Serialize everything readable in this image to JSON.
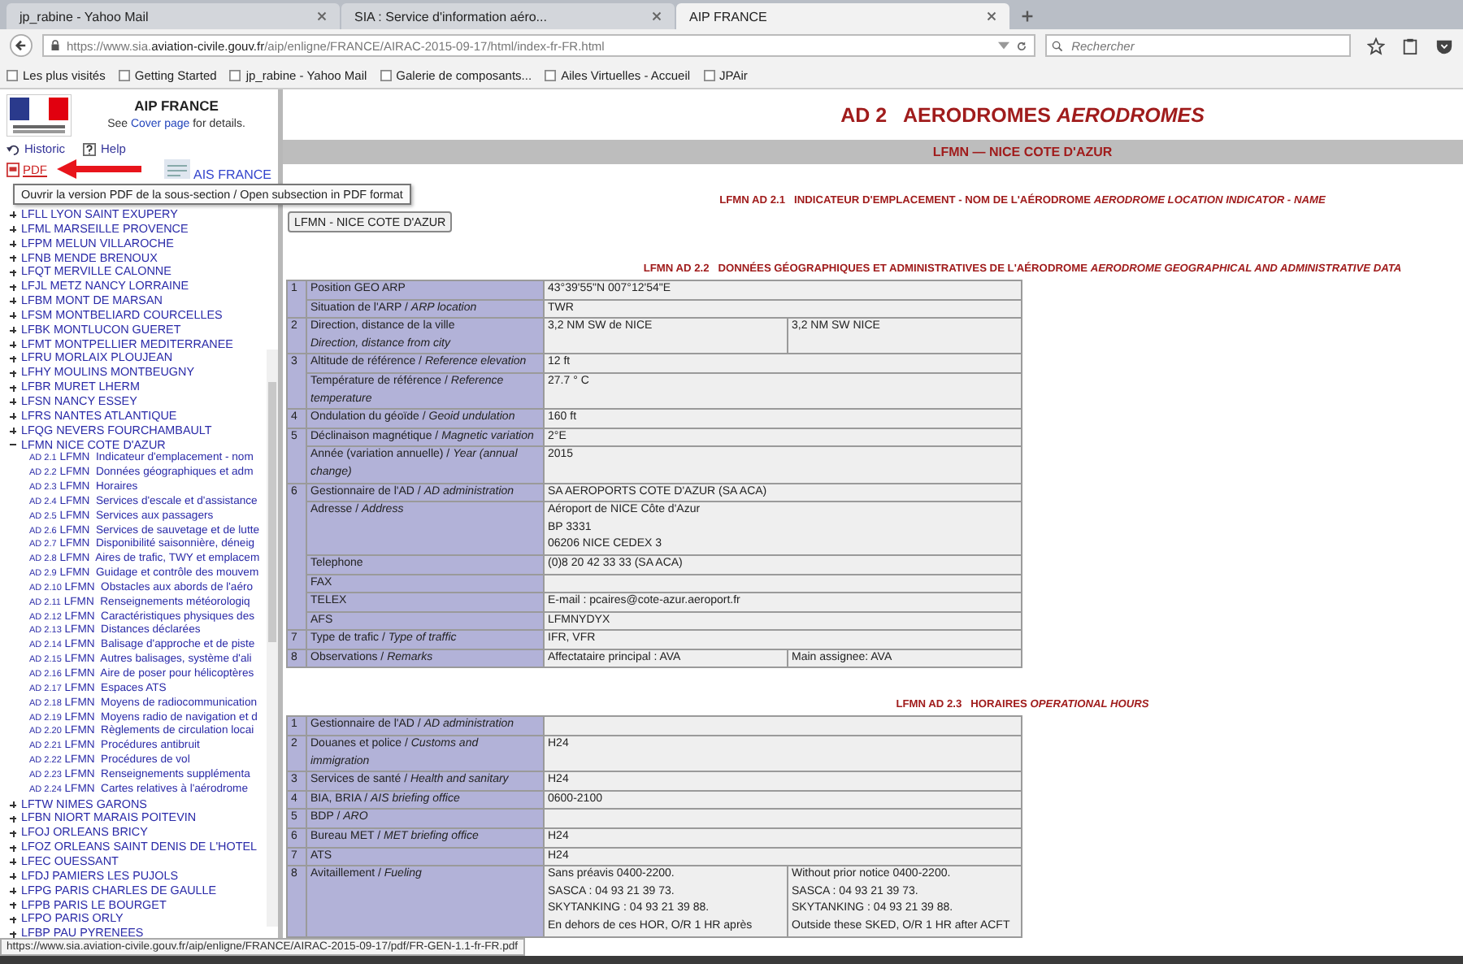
{
  "browser": {
    "tabs": [
      {
        "title": "jp_rabine - Yahoo Mail",
        "selected": false
      },
      {
        "title": "SIA : Service d'information aéro...",
        "selected": false
      },
      {
        "title": "AIP FRANCE",
        "selected": true
      }
    ],
    "url": "https://www.sia.**aviation-civile.gouv.fr**/aip/enligne/FRANCE/AIRAC-2015-09-17/html/index-fr-FR.html",
    "search": {
      "placeholder": "Rechercher"
    },
    "bookmarks": [
      "Les plus visités",
      "Getting Started",
      "jp_rabine - Yahoo Mail",
      "Galerie de composants...",
      "Ailes Virtuelles - Accueil",
      "JPAir"
    ]
  },
  "sidebar": {
    "title": "AIP FRANCE",
    "note": {
      "before": "See",
      "link": "Cover page",
      "after": "for details."
    },
    "links": {
      "historic": "Historic",
      "help": "Help",
      "pdf": "PDF",
      "ais": "AIS FRANCE"
    },
    "tooltip": "Ouvrir la version PDF de la sous-section / Open subsection in PDF format",
    "tree": [
      {
        "label": "LFLL LYON SAINT EXUPERY",
        "expanded": false
      },
      {
        "label": "LFML MARSEILLE PROVENCE",
        "expanded": false
      },
      {
        "label": "LFPM MELUN VILLAROCHE",
        "expanded": false
      },
      {
        "label": "LFNB MENDE BRENOUX",
        "expanded": false
      },
      {
        "label": "LFQT MERVILLE CALONNE",
        "expanded": false
      },
      {
        "label": "LFJL METZ NANCY LORRAINE",
        "expanded": false
      },
      {
        "label": "LFBM MONT DE MARSAN",
        "expanded": false
      },
      {
        "label": "LFSM MONTBELIARD COURCELLES",
        "expanded": false
      },
      {
        "label": "LFBK MONTLUCON GUERET",
        "expanded": false
      },
      {
        "label": "LFMT MONTPELLIER MEDITERRANEE",
        "expanded": false
      },
      {
        "label": "LFRU MORLAIX PLOUJEAN",
        "expanded": false
      },
      {
        "label": "LFHY MOULINS MONTBEUGNY",
        "expanded": false
      },
      {
        "label": "LFBR MURET LHERM",
        "expanded": false
      },
      {
        "label": "LFSN NANCY ESSEY",
        "expanded": false
      },
      {
        "label": "LFRS NANTES ATLANTIQUE",
        "expanded": false
      },
      {
        "label": "LFQG NEVERS FOURCHAMBAULT",
        "expanded": false
      },
      {
        "label": "LFMN NICE COTE D'AZUR",
        "expanded": true,
        "children": [
          {
            "section": "AD 2.1",
            "code": "LFMN",
            "title": "Indicateur d'emplacement - nom"
          },
          {
            "section": "AD 2.2",
            "code": "LFMN",
            "title": "Données géographiques et adm"
          },
          {
            "section": "AD 2.3",
            "code": "LFMN",
            "title": "Horaires"
          },
          {
            "section": "AD 2.4",
            "code": "LFMN",
            "title": "Services d'escale et d'assistance"
          },
          {
            "section": "AD 2.5",
            "code": "LFMN",
            "title": "Services aux passagers"
          },
          {
            "section": "AD 2.6",
            "code": "LFMN",
            "title": "Services de sauvetage et de lutte"
          },
          {
            "section": "AD 2.7",
            "code": "LFMN",
            "title": "Disponibilité saisonnière, déneig"
          },
          {
            "section": "AD 2.8",
            "code": "LFMN",
            "title": "Aires de trafic, TWY et emplacem"
          },
          {
            "section": "AD 2.9",
            "code": "LFMN",
            "title": "Guidage et contrôle des mouvem"
          },
          {
            "section": "AD 2.10",
            "code": "LFMN",
            "title": "Obstacles aux abords de l'aéro"
          },
          {
            "section": "AD 2.11",
            "code": "LFMN",
            "title": "Renseignements météorologiq"
          },
          {
            "section": "AD 2.12",
            "code": "LFMN",
            "title": "Caractéristiques physiques des"
          },
          {
            "section": "AD 2.13",
            "code": "LFMN",
            "title": "Distances déclarées"
          },
          {
            "section": "AD 2.14",
            "code": "LFMN",
            "title": "Balisage d'approche et de piste"
          },
          {
            "section": "AD 2.15",
            "code": "LFMN",
            "title": "Autres balisages, système d'ali"
          },
          {
            "section": "AD 2.16",
            "code": "LFMN",
            "title": "Aire de poser pour hélicoptères"
          },
          {
            "section": "AD 2.17",
            "code": "LFMN",
            "title": "Espaces ATS"
          },
          {
            "section": "AD 2.18",
            "code": "LFMN",
            "title": "Moyens de radiocommunication"
          },
          {
            "section": "AD 2.19",
            "code": "LFMN",
            "title": "Moyens radio de navigation et d"
          },
          {
            "section": "AD 2.20",
            "code": "LFMN",
            "title": "Règlements de circulation locai"
          },
          {
            "section": "AD 2.21",
            "code": "LFMN",
            "title": "Procédures antibruit"
          },
          {
            "section": "AD 2.22",
            "code": "LFMN",
            "title": "Procédures de vol"
          },
          {
            "section": "AD 2.23",
            "code": "LFMN",
            "title": "Renseignements supplémenta"
          },
          {
            "section": "AD 2.24",
            "code": "LFMN",
            "title": "Cartes relatives à l'aérodrome"
          }
        ]
      },
      {
        "label": "LFTW NIMES GARONS",
        "expanded": false
      },
      {
        "label": "LFBN NIORT MARAIS POITEVIN",
        "expanded": false
      },
      {
        "label": "LFOJ ORLEANS BRICY",
        "expanded": false
      },
      {
        "label": "LFOZ ORLEANS SAINT DENIS DE L'HOTEL",
        "expanded": false
      },
      {
        "label": "LFEC OUESSANT",
        "expanded": false
      },
      {
        "label": "LFDJ PAMIERS LES PUJOLS",
        "expanded": false
      },
      {
        "label": "LFPG PARIS CHARLES DE GAULLE",
        "expanded": false
      },
      {
        "label": "LFPB PARIS LE BOURGET",
        "expanded": false
      },
      {
        "label": "LFPO PARIS ORLY",
        "expanded": false
      },
      {
        "label": "LFBP PAU PYRENEES",
        "expanded": false
      }
    ]
  },
  "content": {
    "title": "AD 2   AERODROMES *AERODROMES*",
    "banner": "LFMN — NICE COTE D'AZUR",
    "sections": [
      {
        "heading": "LFMN AD 2.1   INDICATEUR D'EMPLACEMENT - NOM DE L'AÉRODROME *AERODROME LOCATION INDICATOR - NAME*",
        "button": "LFMN - NICE COTE D'AZUR"
      },
      {
        "heading": "LFMN AD 2.2   DONNÉES GÉOGRAPHIQUES ET ADMINISTRATIVES DE L'AÉRODROME *AERODROME GEOGRAPHICAL AND ADMINISTRATIVE DATA*",
        "groups": [
          {
            "num": "1",
            "rows": [
              {
                "label": "Position GEO ARP",
                "values": [
                  "43°39'55\"N 007°12'54\"E"
                ]
              },
              {
                "label": "Situation de l'ARP / *ARP location*",
                "values": [
                  "TWR"
                ]
              }
            ]
          },
          {
            "num": "2",
            "rows": [
              {
                "label": "Direction, distance de la ville\n*Direction, distance from city*",
                "values": [
                  "3,2 NM SW de NICE",
                  "3,2 NM SW NICE"
                ]
              }
            ]
          },
          {
            "num": "3",
            "rows": [
              {
                "label": "Altitude de référence / *Reference elevation*",
                "values": [
                  "12 ft"
                ]
              },
              {
                "label": "Température de référence / *Reference temperature*",
                "values": [
                  "27.7 ° C"
                ]
              }
            ]
          },
          {
            "num": "4",
            "rows": [
              {
                "label": "Ondulation du géoïde / *Geoid undulation*",
                "values": [
                  "160 ft"
                ]
              }
            ]
          },
          {
            "num": "5",
            "rows": [
              {
                "label": "Déclinaison magnétique / *Magnetic variation*",
                "values": [
                  "2°E"
                ]
              },
              {
                "label": "Année (variation annuelle) / *Year (annual change)*",
                "values": [
                  "2015"
                ]
              }
            ]
          },
          {
            "num": "6",
            "rows": [
              {
                "label": "Gestionnaire de l'AD / *AD administration*",
                "values": [
                  "SA AEROPORTS COTE D'AZUR (SA ACA)"
                ]
              },
              {
                "label": "Adresse / *Address*",
                "values": [
                  "Aéroport de NICE Côte d'Azur\nBP 3331\n06206 NICE CEDEX 3"
                ]
              },
              {
                "label": "Telephone",
                "values": [
                  "(0)8 20 42 33 33 (SA ACA)"
                ]
              },
              {
                "label": "FAX"
              },
              {
                "label": "TELEX",
                "values": [
                  "E-mail : pcaires@cote-azur.aeroport.fr"
                ]
              },
              {
                "label": "AFS",
                "values": [
                  "LFMNYDYX"
                ]
              }
            ]
          },
          {
            "num": "7",
            "rows": [
              {
                "label": "Type de trafic / *Type of traffic*",
                "values": [
                  "IFR, VFR"
                ]
              }
            ]
          },
          {
            "num": "8",
            "rows": [
              {
                "label": "Observations / *Remarks*",
                "values": [
                  "Affectataire principal : AVA",
                  "Main assignee: AVA"
                ]
              }
            ]
          }
        ]
      },
      {
        "heading": "LFMN AD 2.3   HORAIRES *OPERATIONAL HOURS*",
        "groups": [
          {
            "num": "1",
            "rows": [
              {
                "label": "Gestionnaire de l'AD / *AD administration*"
              }
            ]
          },
          {
            "num": "2",
            "rows": [
              {
                "label": "Douanes et police / *Customs and immigration*",
                "values": [
                  "H24"
                ]
              }
            ]
          },
          {
            "num": "3",
            "rows": [
              {
                "label": "Services de santé / *Health and sanitary*",
                "values": [
                  "H24"
                ]
              }
            ]
          },
          {
            "num": "4",
            "rows": [
              {
                "label": "BIA, BRIA / *AIS briefing office*",
                "values": [
                  "0600-2100"
                ]
              }
            ]
          },
          {
            "num": "5",
            "rows": [
              {
                "label": "BDP / *ARO*"
              }
            ]
          },
          {
            "num": "6",
            "rows": [
              {
                "label": "Bureau MET / *MET briefing office*",
                "values": [
                  "H24"
                ]
              }
            ]
          },
          {
            "num": "7",
            "rows": [
              {
                "label": "ATS",
                "values": [
                  "H24"
                ]
              }
            ]
          },
          {
            "num": "8",
            "rows": [
              {
                "label": "Avitaillement / *Fueling*",
                "values": [
                  "Sans préavis 0400-2200.\nSASCA : 04 93 21 39 73.\nSKYTANKING : 04 93 21 39 88.\nEn dehors de ces HOR, O/R 1 HR après",
                  "Without prior notice 0400-2200.\nSASCA : 04 93 21 39 73.\nSKYTANKING : 04 93 21 39 88.\nOutside these SKED, O/R 1 HR after ACFT"
                ]
              }
            ]
          }
        ]
      }
    ]
  },
  "status_bar": "https://www.sia.aviation-civile.gouv.fr/aip/enligne/FRANCE/AIRAC-2015-09-17/pdf/FR-GEN-1.1-fr-FR.pdf"
}
